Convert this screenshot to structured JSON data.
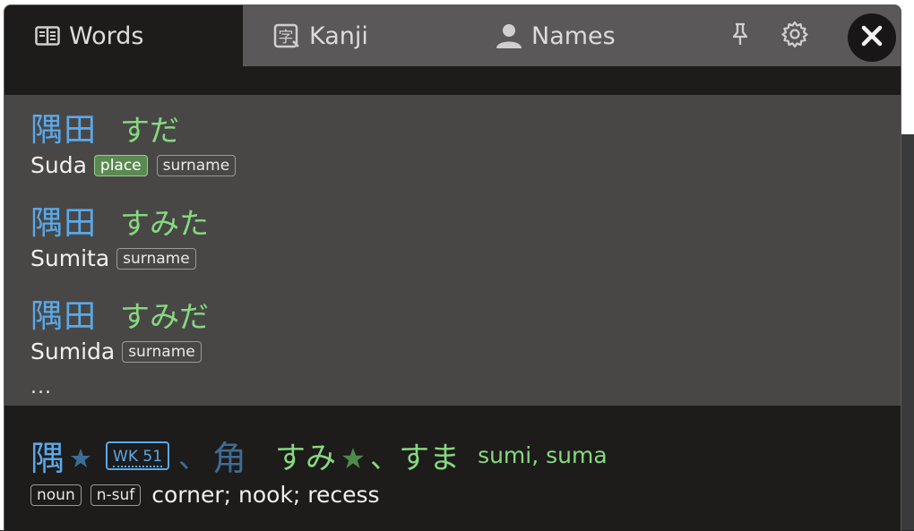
{
  "tabs": {
    "words": "Words",
    "kanji": "Kanji",
    "names": "Names"
  },
  "entries": [
    {
      "kanji": "隅田",
      "kana": "すだ",
      "romaji": "Suda",
      "tags": [
        "place",
        "surname"
      ]
    },
    {
      "kanji": "隅田",
      "kana": "すみた",
      "romaji": "Sumita",
      "tags": [
        "surname"
      ]
    },
    {
      "kanji": "隅田",
      "kana": "すみだ",
      "romaji": "Sumida",
      "tags": [
        "surname"
      ]
    }
  ],
  "more": "...",
  "kanji_entry": {
    "headword": "隅",
    "wk_badge": "WK 51",
    "separator": "、",
    "alt_headword": "角",
    "reading_1": "すみ",
    "reading_separator": "、",
    "reading_2": "すま",
    "romaji": "sumi, suma",
    "tags": [
      "noun",
      "n-suf"
    ],
    "gloss": "corner; nook; recess"
  },
  "colors": {
    "kanji": "#5aa9e8",
    "kana": "#86d980",
    "place_tag": "#5a8a52",
    "background": "#1e1b1b",
    "results_bg": "#484746"
  },
  "icons": {
    "words": "book-icon",
    "kanji": "kanji-card-icon",
    "names": "person-icon",
    "pin": "pin-icon",
    "settings": "gear-icon",
    "close": "close-icon",
    "star": "star-icon"
  }
}
